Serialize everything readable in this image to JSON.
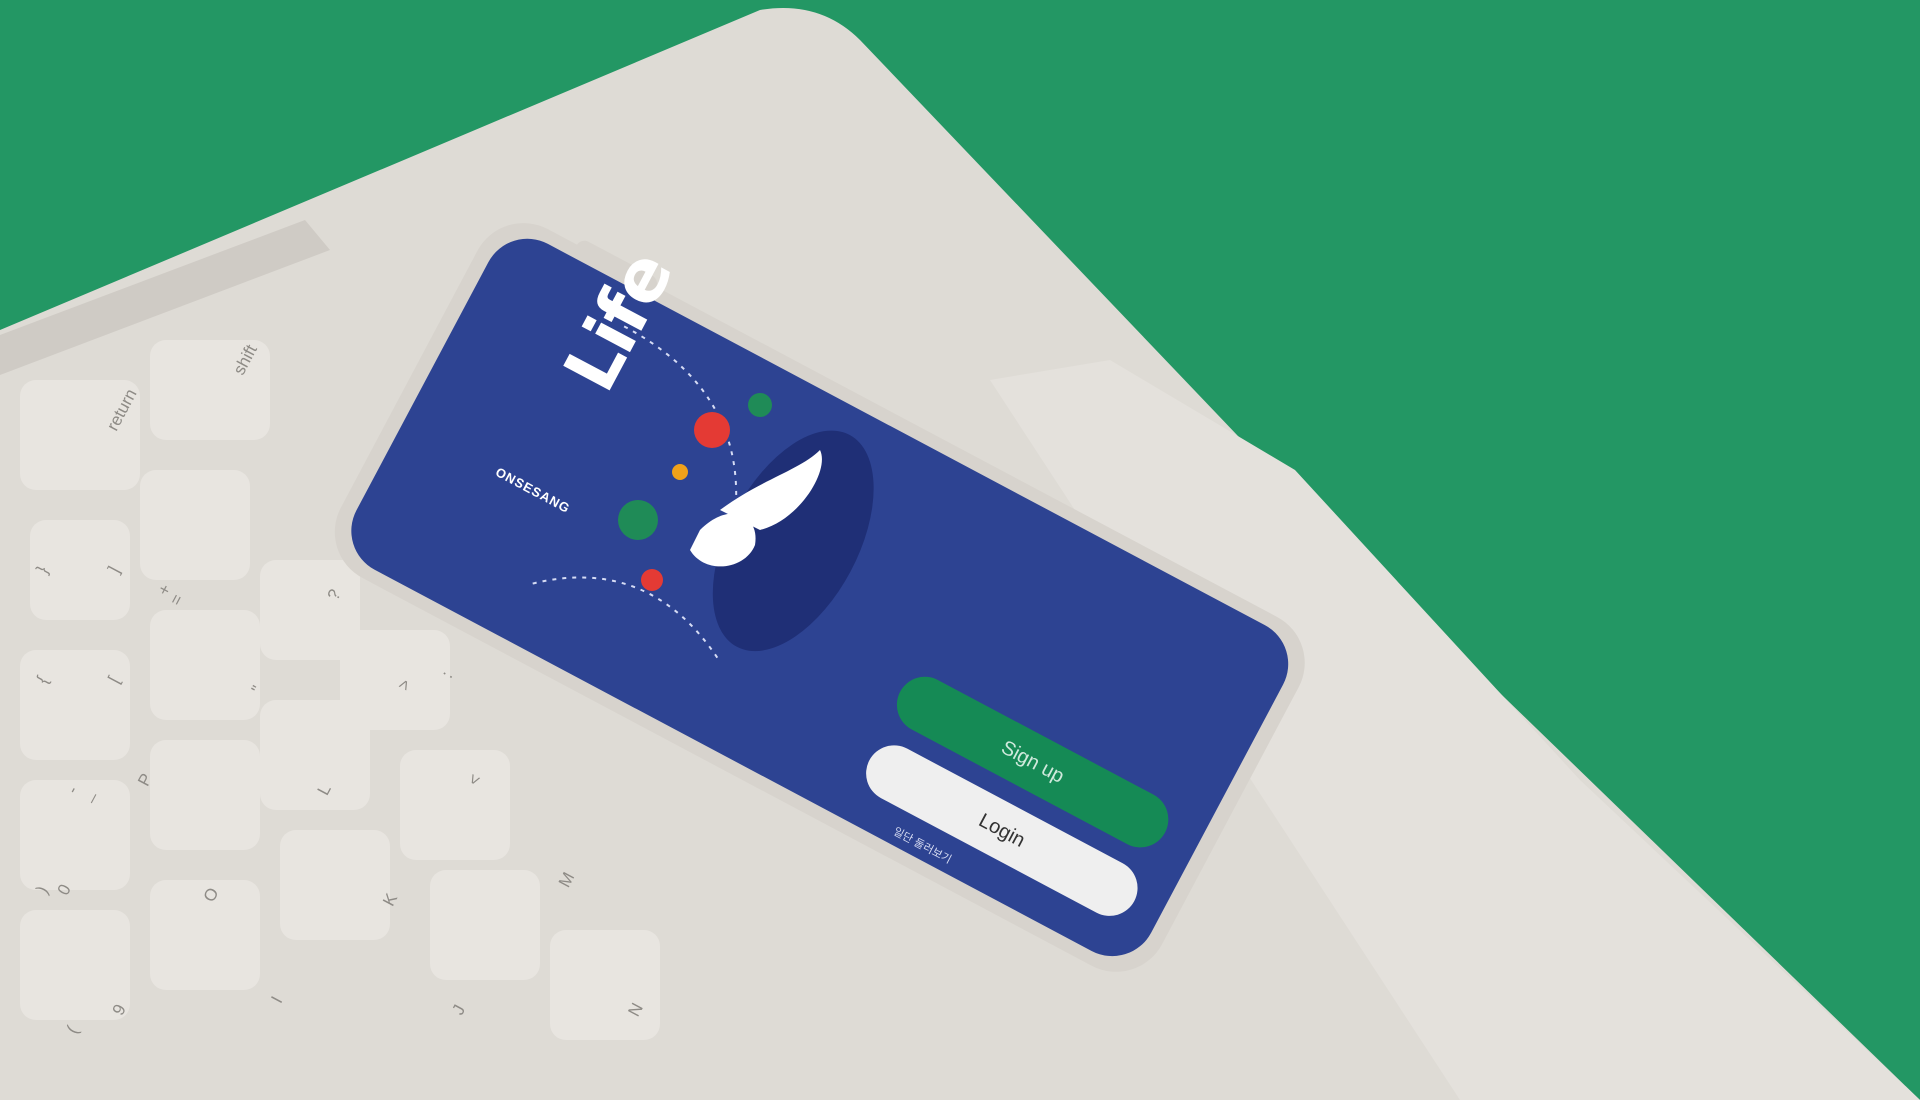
{
  "app": {
    "logo_text": "Life",
    "brand_name": "ONSESANG",
    "signup_label": "Sign up",
    "login_label": "Login",
    "hint_text": "일단 둘러보기"
  },
  "keyboard": {
    "keys": [
      "shift",
      "return",
      "?",
      ":",
      "\"",
      "<",
      ">",
      "{",
      "[",
      "}",
      "]",
      "P",
      "L",
      "M",
      "K",
      "N",
      "J",
      "O",
      "I",
      ")",
      "(",
      "9",
      "0",
      "+",
      "=",
      "-",
      "_"
    ]
  },
  "colors": {
    "background": "#239764",
    "laptop": "#dedbd5",
    "screen": "#2d4392",
    "signup": "#158a55",
    "login": "#efefef",
    "icon_red": "#e43a34",
    "icon_green": "#1f8b57",
    "icon_yellow": "#f0a11a"
  },
  "icons": [
    "fish-icon",
    "cat-face-icon",
    "bone-icon",
    "medical-cross-icon",
    "coin-icon",
    "cat-illustration-icon",
    "dog-illustration-icon"
  ]
}
